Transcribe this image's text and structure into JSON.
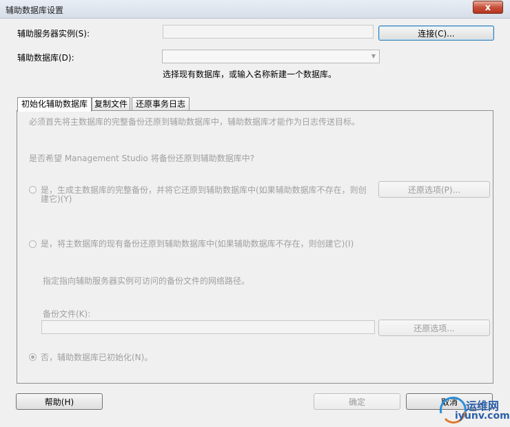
{
  "window": {
    "title": "辅助数据库设置",
    "close_symbol": "x"
  },
  "server": {
    "label": "辅助服务器实例(S):",
    "value": "",
    "connect_button": "连接(C)..."
  },
  "database": {
    "label": "辅助数据库(D):",
    "value": "",
    "hint": "选择现有数据库，或输入名称新建一个数据库。"
  },
  "tabs": [
    {
      "label": "初始化辅助数据库",
      "active": true
    },
    {
      "label": "复制文件",
      "active": false
    },
    {
      "label": "还原事务日志",
      "active": false
    }
  ],
  "panel": {
    "intro": "必须首先将主数据库的完整备份还原到辅助数据库中，辅助数据库才能作为日志传送目标。",
    "question": "是否希望 Management Studio 将备份还原到辅助数据库中?",
    "option1": {
      "line1": "是，生成主数据库的完整备份，并将它还原到辅助数据库中(如果辅助数据库不存在，则创",
      "line2": "建它)(Y)",
      "checked": false,
      "button": "还原选项(P)..."
    },
    "option2": {
      "label": "是，将主数据库的现有备份还原到辅助数据库中(如果辅助数据库不存在，则创建它)(I)",
      "checked": false
    },
    "path_hint": "指定指向辅助服务器实例可访问的备份文件的网络路径。",
    "backup_file": {
      "label": "备份文件(K):",
      "value": "",
      "button": "还原选项..."
    },
    "option3": {
      "label": "否，辅助数据库已初始化(N)。",
      "checked": true
    }
  },
  "footer": {
    "help": "帮助(H)",
    "ok": "确定",
    "cancel": "取消"
  },
  "watermark": {
    "name": "运维网",
    "url": "iyunv.com"
  }
}
